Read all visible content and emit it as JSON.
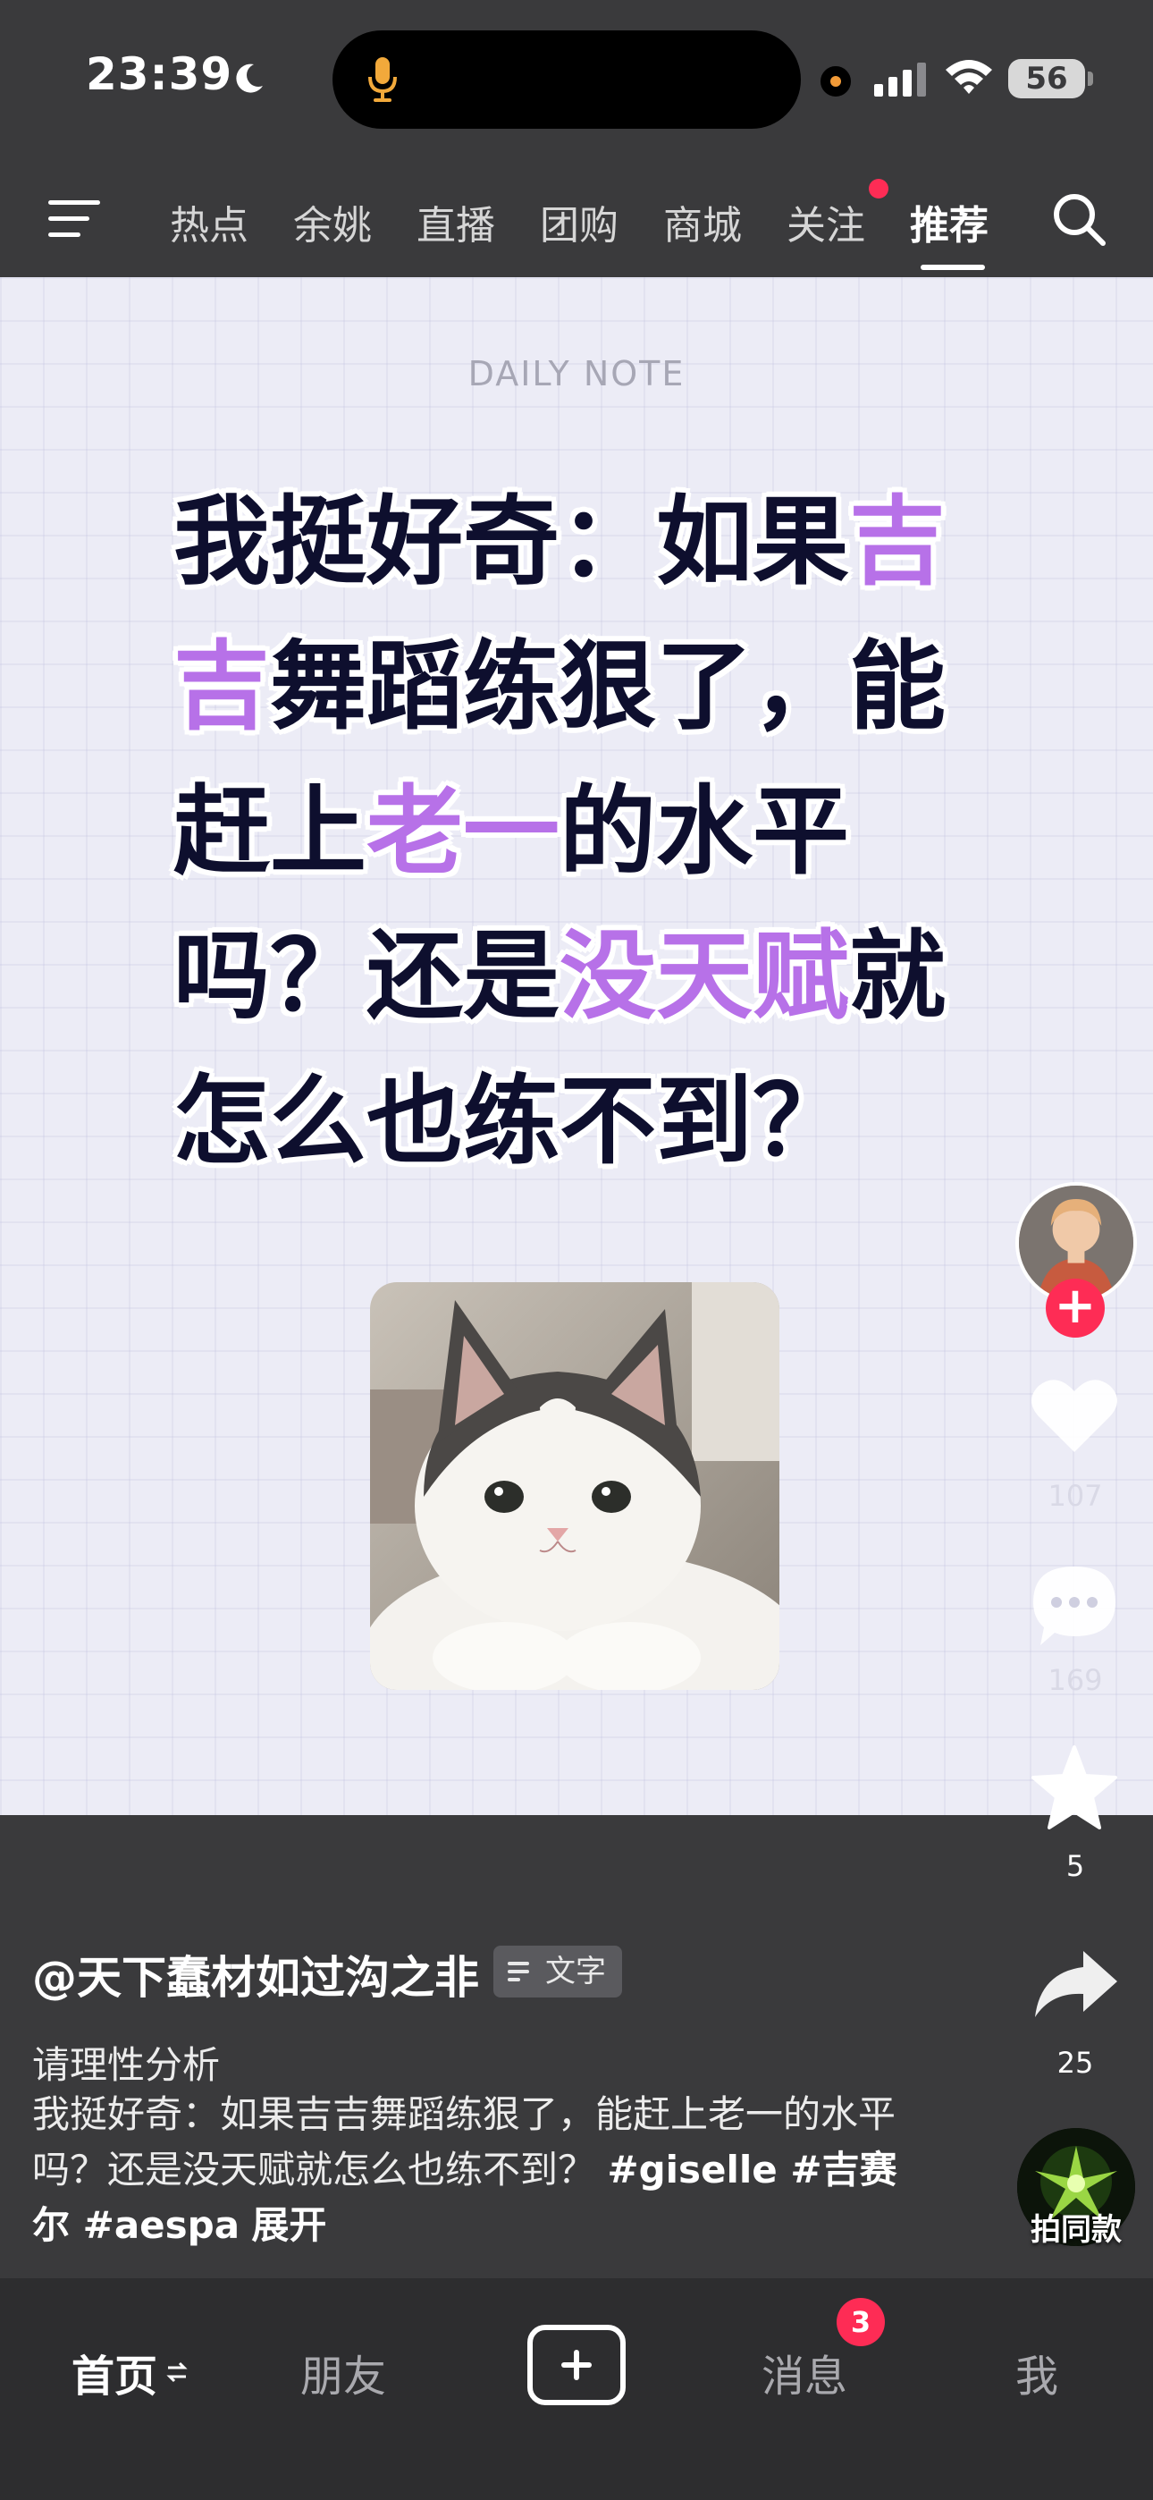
{
  "status_bar": {
    "time": "23:39",
    "battery": "56",
    "moon_icon": "moon-icon",
    "mic_icon": "microphone-icon",
    "signal_icon": "cellular-signal-icon",
    "wifi_icon": "wifi-icon"
  },
  "top_nav": {
    "tabs": [
      {
        "label": "热点"
      },
      {
        "label": "余姚"
      },
      {
        "label": "直播"
      },
      {
        "label": "团购"
      },
      {
        "label": "商城"
      },
      {
        "label": "关注"
      },
      {
        "label": "推荐"
      }
    ],
    "active_tab": "推荐",
    "menu_icon": "hamburger-menu-icon",
    "search_icon": "search-icon"
  },
  "post": {
    "daily_note": "DAILY NOTE",
    "headline": {
      "l1a": "我挺好奇：如果",
      "l1b": "吉",
      "l2a": "吉",
      "l2b": "舞蹈练狠了，能",
      "l3a": "赶上",
      "l3b": "老一",
      "l3c": "的水平",
      "l4a": "吗？还是",
      "l4b": "没天赋",
      "l4c": "就",
      "l5": "怎么也练不到？"
    },
    "highlight_color": "#b771e8",
    "image": "cat-photo"
  },
  "actions": {
    "follow_plus": "+",
    "likes": "107",
    "comments": "169",
    "favorites": "5",
    "shares": "25",
    "remix_label": "拍同款"
  },
  "caption": {
    "author": "@天下蠢材如过沟之非",
    "badge": "文字",
    "title": "请理性分析",
    "body": "我挺好奇：如果吉吉舞蹈练狠了，能赶上老一的水平吗？还是没天赋就怎么也练不到？",
    "tags": "#giselle #吉赛尔 #aespa",
    "expand": "展开"
  },
  "bottom_bar": {
    "home": "首页",
    "friends": "朋友",
    "messages": "消息",
    "messages_badge": "3",
    "me": "我"
  }
}
